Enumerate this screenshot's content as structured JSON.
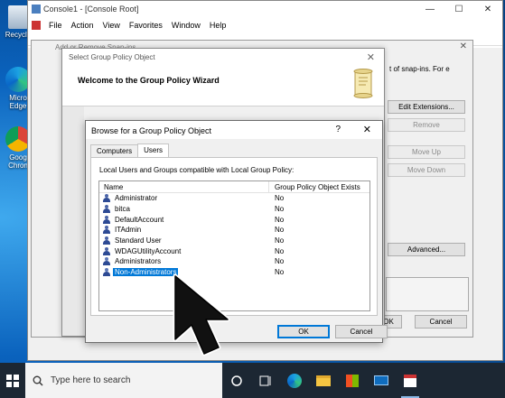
{
  "desktop": {
    "icons": [
      {
        "label": "Recycle"
      },
      {
        "label": "Micro Edge"
      },
      {
        "label": "Goog Chron"
      }
    ]
  },
  "console": {
    "title": "Console1 - [Console Root]",
    "menu": [
      "File",
      "Action",
      "View",
      "Favorites",
      "Window",
      "Help"
    ],
    "window_controls": {
      "minimize": "—",
      "maximize": "☐",
      "close": "✕"
    }
  },
  "snapins_dialog": {
    "title": "Add or Remove Snap-ins",
    "description_fragment": "t of snap-ins. For e",
    "buttons": {
      "edit_extensions": "Edit Extensions...",
      "remove": "Remove",
      "move_up": "Move Up",
      "move_down": "Move Down",
      "advanced": "Advanced...",
      "ok": "OK",
      "cancel": "Cancel"
    }
  },
  "wizard": {
    "title": "Select Group Policy Object",
    "heading": "Welcome to the Group Policy Wizard"
  },
  "browse": {
    "title": "Browse for a Group Policy Object",
    "help": "?",
    "close": "✕",
    "tabs": [
      "Computers",
      "Users"
    ],
    "active_tab": "Users",
    "caption": "Local Users and Groups compatible with Local Group Policy:",
    "columns": [
      "Name",
      "Group Policy Object Exists"
    ],
    "rows": [
      {
        "name": "Administrator",
        "exists": "No",
        "type": "user"
      },
      {
        "name": "bitca",
        "exists": "No",
        "type": "user"
      },
      {
        "name": "DefaultAccount",
        "exists": "No",
        "type": "user"
      },
      {
        "name": "ITAdmin",
        "exists": "No",
        "type": "user"
      },
      {
        "name": "Standard User",
        "exists": "No",
        "type": "user"
      },
      {
        "name": "WDAGUtilityAccount",
        "exists": "No",
        "type": "user"
      },
      {
        "name": "Administrators",
        "exists": "No",
        "type": "group"
      },
      {
        "name": "Non-Administrators",
        "exists": "No",
        "type": "group",
        "selected": true
      }
    ],
    "buttons": {
      "ok": "OK",
      "cancel": "Cancel"
    }
  },
  "taskbar": {
    "search_placeholder": "Type here to search",
    "icons": [
      "task-view-icon",
      "edge-icon",
      "file-explorer-icon",
      "store-icon",
      "mail-icon",
      "mmc-icon"
    ]
  }
}
